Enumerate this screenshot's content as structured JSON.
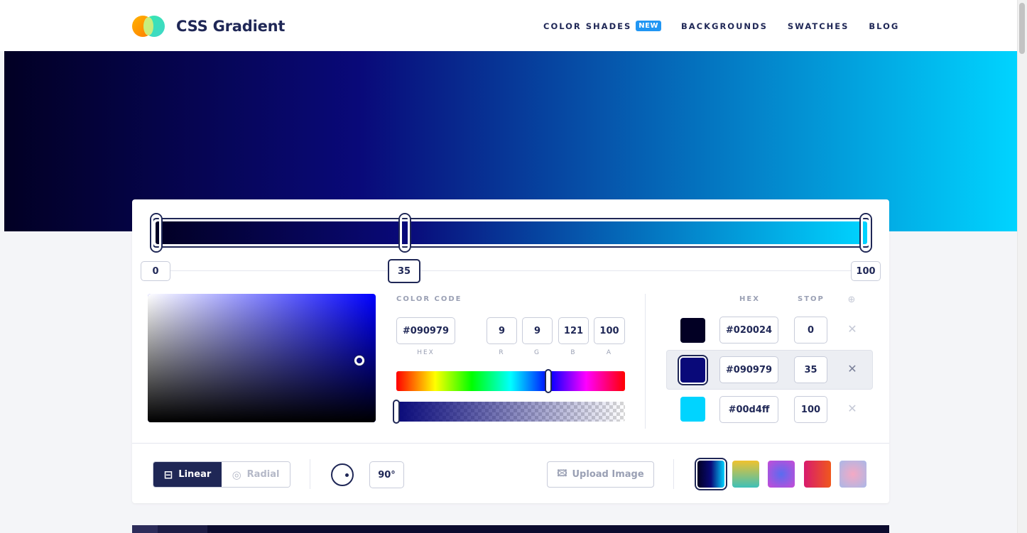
{
  "brand": {
    "name": "CSS Gradient"
  },
  "nav": {
    "items": [
      {
        "label": "COLOR SHADES",
        "badge": "NEW"
      },
      {
        "label": "BACKGROUNDS"
      },
      {
        "label": "SWATCHES"
      },
      {
        "label": "BLOG"
      }
    ]
  },
  "gradient": {
    "type": "linear",
    "angle": "90°",
    "stops": [
      {
        "hex": "#020024",
        "stop": "0"
      },
      {
        "hex": "#090979",
        "stop": "35"
      },
      {
        "hex": "#00d4ff",
        "stop": "100"
      }
    ],
    "active_stop": 1
  },
  "stop_markers": [
    "0",
    "35",
    "100"
  ],
  "color_code": {
    "title": "COLOR CODE",
    "hex": "#090979",
    "hex_label": "HEX",
    "r": "9",
    "g": "9",
    "b": "121",
    "a": "100",
    "r_label": "R",
    "g_label": "G",
    "b_label": "B",
    "a_label": "A"
  },
  "stops_table": {
    "hex_header": "HEX",
    "stop_header": "STOP",
    "add_icon": "⊕"
  },
  "controls": {
    "linear_label": "Linear",
    "radial_label": "Radial",
    "angle_value": "90°",
    "upload_label": "Upload Image"
  },
  "presets": [
    {
      "name": "preset-1",
      "colors": [
        "#020024",
        "#090979",
        "#00d4ff"
      ],
      "active": true
    },
    {
      "name": "preset-2",
      "colors": [
        "#f0c22e",
        "#3ec0b8"
      ]
    },
    {
      "name": "preset-3",
      "colors": [
        "#c84bd6",
        "#5a6cf0"
      ]
    },
    {
      "name": "preset-4",
      "colors": [
        "#d81b6e",
        "#f0581c"
      ]
    },
    {
      "name": "preset-5",
      "colors": [
        "#a9b8e8",
        "#f4a9c4"
      ]
    }
  ]
}
